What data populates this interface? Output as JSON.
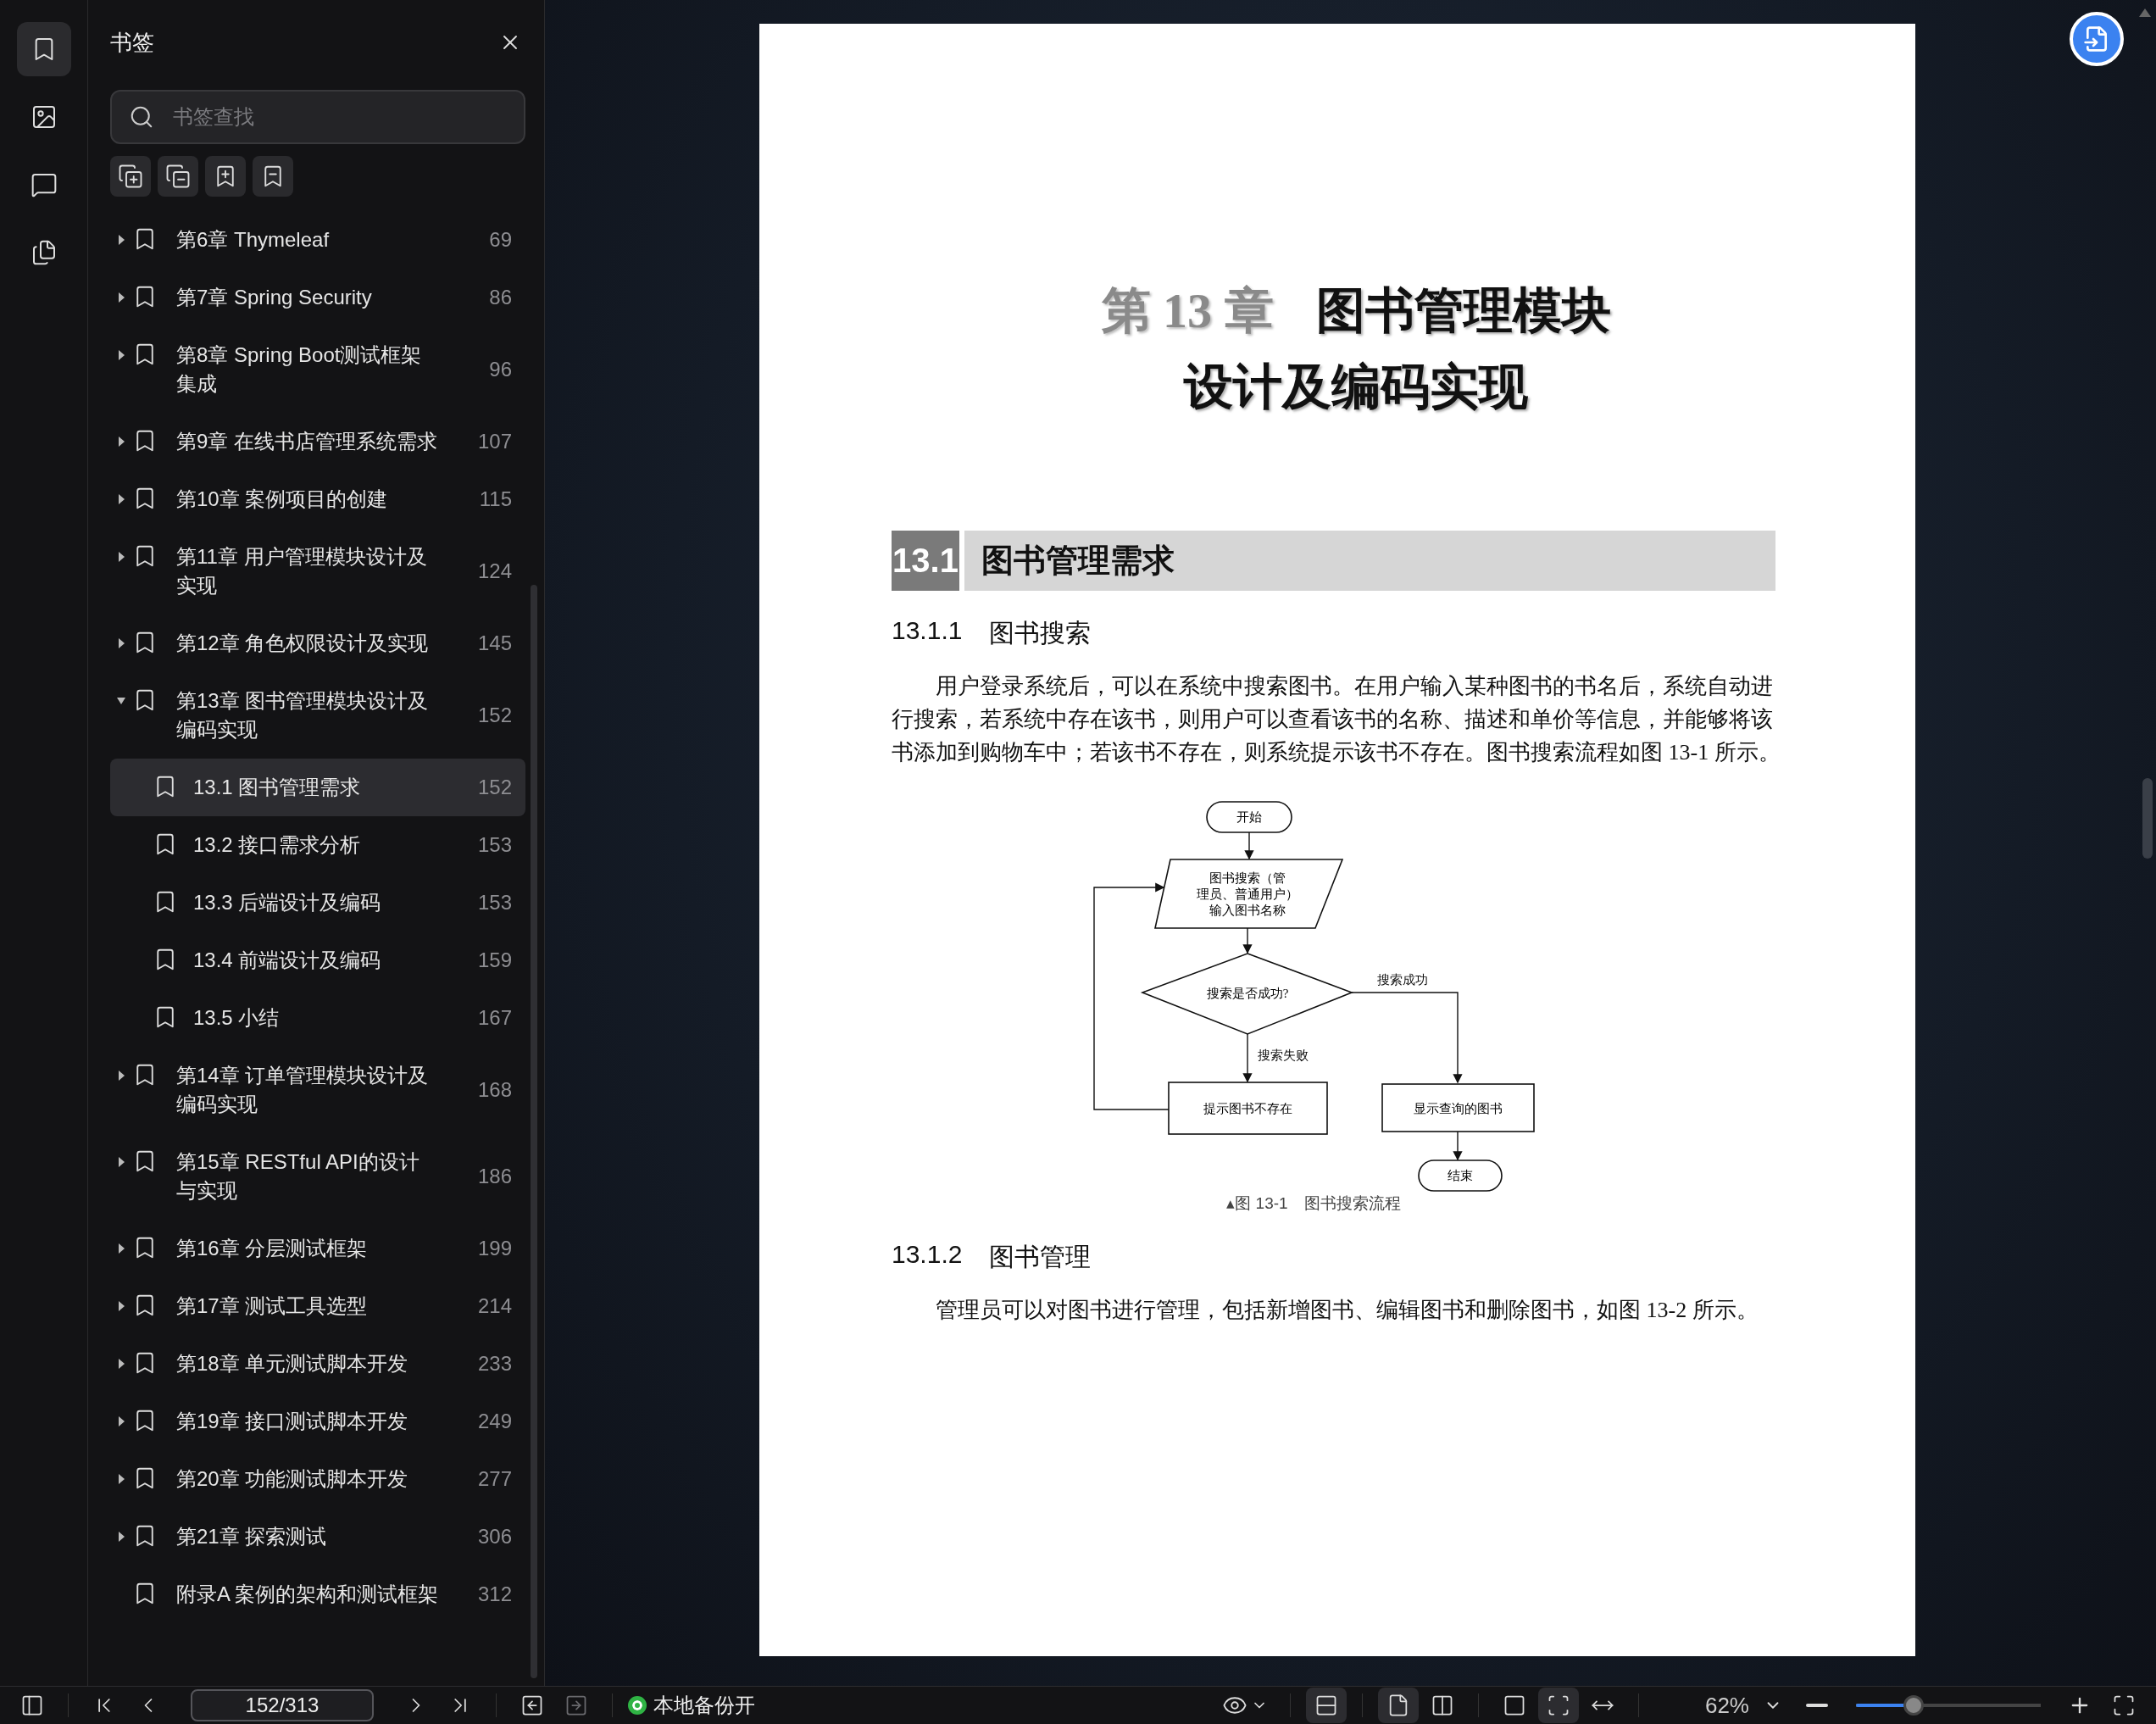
{
  "rail": [
    {
      "kind": "bookmarks",
      "selected": true
    },
    {
      "kind": "images",
      "selected": false
    },
    {
      "kind": "comments",
      "selected": false
    },
    {
      "kind": "convert",
      "selected": false
    }
  ],
  "sidebar": {
    "title": "书签",
    "search": {
      "placeholder": "书签查找"
    },
    "tools": [
      {
        "kind": "expand_all"
      },
      {
        "kind": "collapse_all"
      },
      {
        "kind": "add"
      },
      {
        "kind": "remove"
      }
    ],
    "items": [
      {
        "title": "第6章 Thymeleaf",
        "page": "69",
        "expanded": false,
        "selected": false
      },
      {
        "title": "第7章 Spring Security",
        "page": "86",
        "expanded": false,
        "selected": false
      },
      {
        "title": "第8章 Spring Boot测试框架集成",
        "page": "96",
        "expanded": false,
        "selected": false
      },
      {
        "title": "第9章 在线书店管理系统需求",
        "page": "107",
        "expanded": false,
        "selected": false
      },
      {
        "title": "第10章 案例项目的创建",
        "page": "115",
        "expanded": false,
        "selected": false
      },
      {
        "title": "第11章 用户管理模块设计及实现",
        "page": "124",
        "expanded": false,
        "selected": false
      },
      {
        "title": "第12章 角色权限设计及实现",
        "page": "145",
        "expanded": false,
        "selected": false
      },
      {
        "title": "第13章 图书管理模块设计及编码实现",
        "page": "152",
        "expanded": true,
        "selected": false,
        "children": [
          {
            "title": "13.1 图书管理需求",
            "page": "152",
            "selected": true
          },
          {
            "title": "13.2 接口需求分析",
            "page": "153",
            "selected": false
          },
          {
            "title": "13.3 后端设计及编码",
            "page": "153",
            "selected": false
          },
          {
            "title": "13.4 前端设计及编码",
            "page": "159",
            "selected": false
          },
          {
            "title": "13.5 小结",
            "page": "167",
            "selected": false
          }
        ]
      },
      {
        "title": "第14章 订单管理模块设计及编码实现",
        "page": "168",
        "expanded": false,
        "selected": false
      },
      {
        "title": "第15章 RESTful API的设计与实现",
        "page": "186",
        "expanded": false,
        "selected": false
      },
      {
        "title": "第16章 分层测试框架",
        "page": "199",
        "expanded": false,
        "selected": false
      },
      {
        "title": "第17章 测试工具选型",
        "page": "214",
        "expanded": false,
        "selected": false
      },
      {
        "title": "第18章 单元测试脚本开发",
        "page": "233",
        "expanded": false,
        "selected": false
      },
      {
        "title": "第19章 接口测试脚本开发",
        "page": "249",
        "expanded": false,
        "selected": false
      },
      {
        "title": "第20章 功能测试脚本开发",
        "page": "277",
        "expanded": false,
        "selected": false
      },
      {
        "title": "第21章 探索测试",
        "page": "306",
        "expanded": false,
        "selected": false
      },
      {
        "title": "附录A 案例的架构和测试框架",
        "page": "312",
        "selected": false
      }
    ]
  },
  "page": {
    "chapter_number": "第 13 章",
    "chapter_title": "图书管理模块",
    "chapter_title_line2": "设计及编码实现",
    "section_number": "13.1",
    "section_title": "图书管理需求",
    "subsections": [
      {
        "number": "13.1.1",
        "title": "图书搜索",
        "paragraph": "用户登录系统后，可以在系统中搜索图书。在用户输入某种图书的书名后，系统自动进行搜索，若系统中存在该书，则用户可以查看该书的名称、描述和单价等信息，并能够将该书添加到购物车中；若该书不存在，则系统提示该书不存在。图书搜索流程如图 13-1 所示。",
        "figure": {
          "start": "开始",
          "input": [
            "图书搜索（管",
            "理员、普通用户）",
            "输入图书名称"
          ],
          "decision": "搜索是否成功?",
          "yes_label": "搜索成功",
          "no_label": "搜索失败",
          "fail_box": "提示图书不存在",
          "success_box": "显示查询的图书",
          "end": "结束",
          "caption": "▴图 13-1　图书搜索流程"
        }
      },
      {
        "number": "13.1.2",
        "title": "图书管理",
        "paragraph": "管理员可以对图书进行管理，包括新增图书、编辑图书和删除图书，如图 13-2 所示。"
      }
    ]
  },
  "bottom_bar": {
    "page_field": "152/313",
    "history": [
      {
        "kind": "back",
        "disabled": false
      },
      {
        "kind": "forward",
        "disabled": true
      }
    ],
    "backup": {
      "label": "本地备份开",
      "on": true
    },
    "view_buttons": [
      {
        "kind": "continuous",
        "selected": true
      },
      {
        "kind": "single",
        "selected": true
      },
      {
        "kind": "double",
        "selected": false
      },
      {
        "kind": "actual_size",
        "selected": false
      },
      {
        "kind": "fit_page",
        "selected": true
      },
      {
        "kind": "fit_width",
        "selected": false
      }
    ],
    "zoom": "62%",
    "zoom_slider": {
      "level": 0.31
    }
  }
}
